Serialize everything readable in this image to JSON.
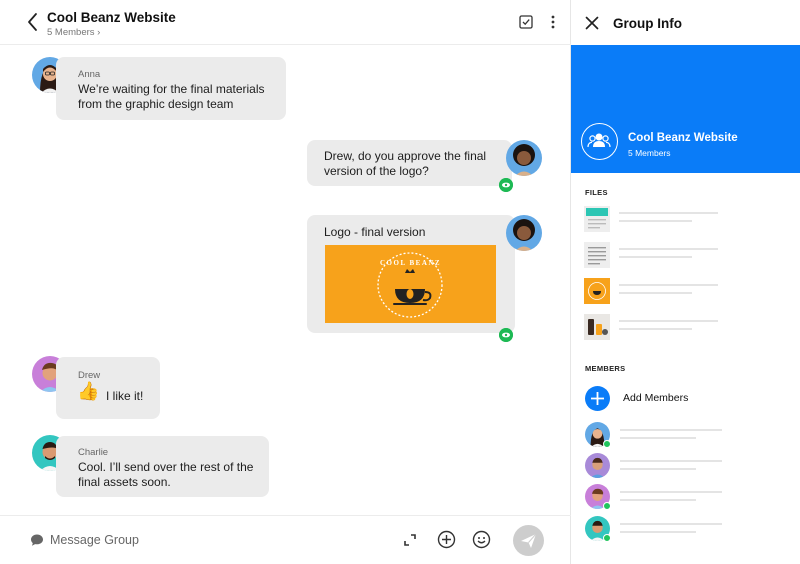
{
  "header": {
    "title": "Cool Beanz Website",
    "members_link": "5 Members ›"
  },
  "messages": [
    {
      "sender": "Anna",
      "lines": [
        "We’re waiting for the final materials",
        "from the graphic design team"
      ]
    },
    {
      "sender": "",
      "lines": [
        "Drew, do you approve the final",
        "version of the logo?"
      ]
    },
    {
      "sender": "",
      "lines": [
        "Logo - final version"
      ],
      "image_text": "COOL BEANZ"
    },
    {
      "sender": "Drew",
      "emoji": "👍",
      "lines": [
        "I like it!"
      ]
    },
    {
      "sender": "Charlie",
      "lines": [
        "Cool. I’ll send over the rest of the",
        "final assets soon."
      ]
    }
  ],
  "composer": {
    "placeholder": "Message Group"
  },
  "info": {
    "title": "Group Info",
    "group_name": "Cool Beanz Website",
    "group_members": "5 Members",
    "files_label": "FILES",
    "members_label": "MEMBERS",
    "add_members": "Add Members"
  },
  "colors": {
    "accent": "#0a7cf8",
    "bubble": "#ebebeb",
    "seen": "#1db954",
    "logo_bg": "#f7a21b",
    "online": "#22c55e"
  }
}
